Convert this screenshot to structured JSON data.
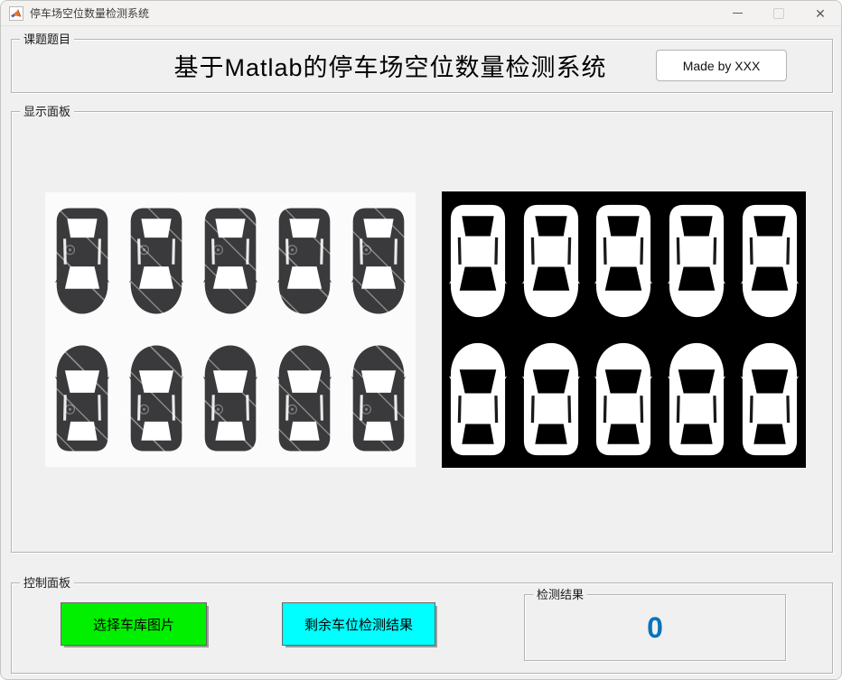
{
  "window": {
    "title": "停车场空位数量检测系统",
    "controls": {
      "close_glyph": "✕"
    }
  },
  "panels": {
    "topic": {
      "label": "课题题目",
      "title": "基于Matlab的停车场空位数量检测系统",
      "made_by_button": "Made by XXX"
    },
    "display": {
      "label": "显示面板",
      "original_image": {
        "name": "parking-lot-photo",
        "rows": 2,
        "cols": 5,
        "car_count": 10
      },
      "binary_image": {
        "name": "parking-lot-binary-mask",
        "rows": 2,
        "cols": 5,
        "car_count": 10
      }
    },
    "control": {
      "label": "控制面板",
      "select_button": "选择车库图片",
      "detect_button": "剩余车位检测结果",
      "result_panel": {
        "label": "检测结果",
        "value": "0"
      }
    }
  },
  "colors": {
    "select_button_bg": "#00f000",
    "detect_button_bg": "#00ffff",
    "result_value": "#0a72bd",
    "original_bg": "#fbfbfb",
    "original_car_body": "#3a3a3c",
    "original_glass": "#ffffff",
    "binary_bg": "#000000",
    "binary_car_body": "#ffffff",
    "binary_glass": "#000000"
  }
}
